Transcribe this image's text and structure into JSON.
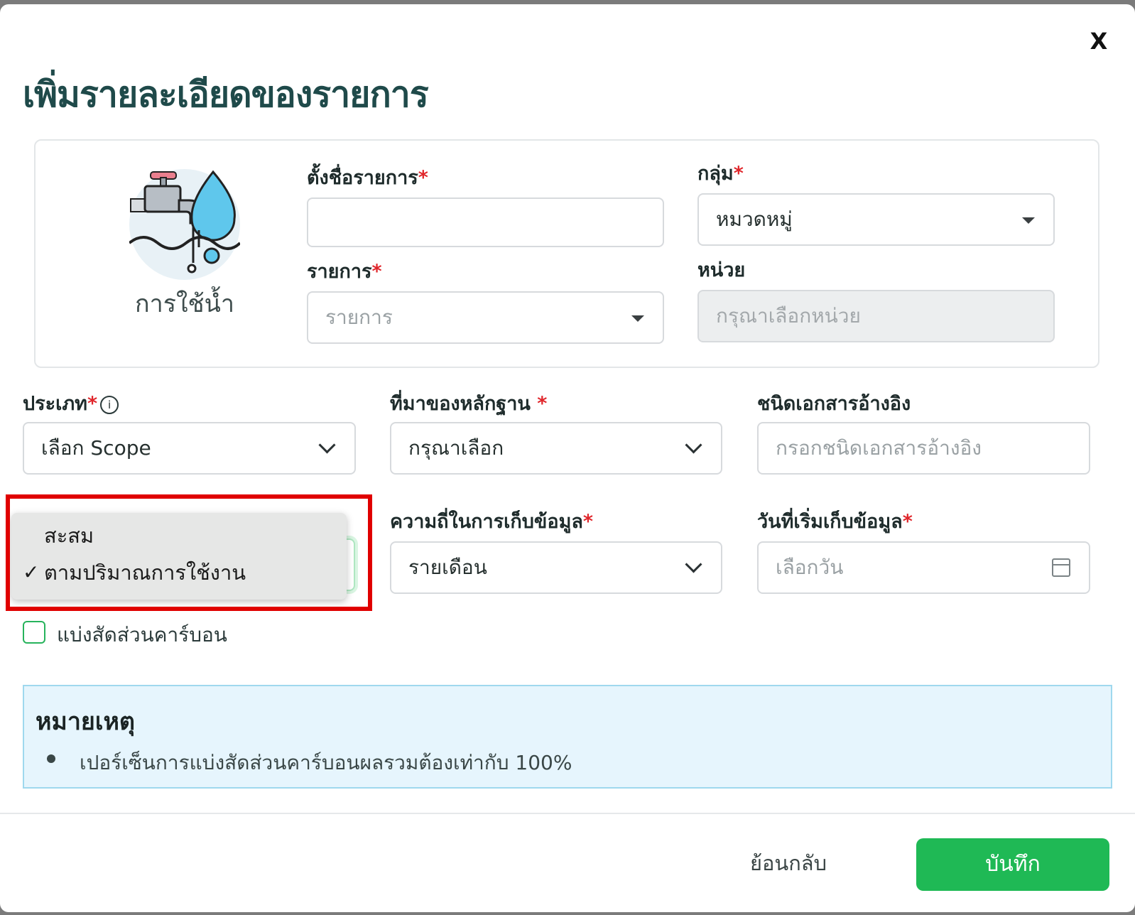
{
  "dialog": {
    "title": "เพิ่มรายละเอียดของรายการ",
    "close_label": "X"
  },
  "category": {
    "icon": "water-tap-icon",
    "label": "การใช้น้ำ"
  },
  "fields": {
    "item_name": {
      "label": "ตั้งชื่อรายการ",
      "required": "*",
      "value": ""
    },
    "group": {
      "label": "กลุ่ม",
      "required": "*",
      "value": "หมวดหมู่"
    },
    "item": {
      "label": "รายการ",
      "required": "*",
      "placeholder": "รายการ"
    },
    "unit": {
      "label": "หน่วย",
      "placeholder": "กรุณาเลือกหน่วย"
    },
    "type": {
      "label": "ประเภท",
      "required": "*",
      "info": "i",
      "value": "เลือก Scope"
    },
    "evidence_source": {
      "label": "ที่มาของหลักฐาน",
      "required": " *",
      "value": "กรุณาเลือก"
    },
    "ref_doc": {
      "label": "ชนิดเอกสารอ้างอิง",
      "placeholder": "กรอกชนิดเอกสารอ้างอิง"
    },
    "frequency": {
      "label": "ความถี่ในการเก็บข้อมูล",
      "required": "*",
      "value": "รายเดือน"
    },
    "start_date": {
      "label": "วันที่เริ่มเก็บข้อมูล",
      "required": "*",
      "placeholder": "เลือกวัน"
    }
  },
  "dropdown_menu": {
    "options": [
      {
        "label": "สะสม",
        "check": ""
      },
      {
        "label": "ตามปริมาณการใช้งาน",
        "check": "✓"
      }
    ]
  },
  "carbon_split": {
    "label": "แบ่งสัดส่วนคาร์บอน",
    "checked": false
  },
  "note": {
    "title": "หมายเหตุ",
    "items": [
      "เปอร์เซ็นการแบ่งสัดส่วนคาร์บอนผลรวมต้องเท่ากับ 100%"
    ]
  },
  "footer": {
    "back_label": "ย้อนกลับ",
    "save_label": "บันทึก"
  },
  "colors": {
    "primary": "#1fb955",
    "required": "#e0262b",
    "title": "#1f4a4a",
    "note_bg": "#e6f5fd",
    "highlight": "#e00000"
  }
}
